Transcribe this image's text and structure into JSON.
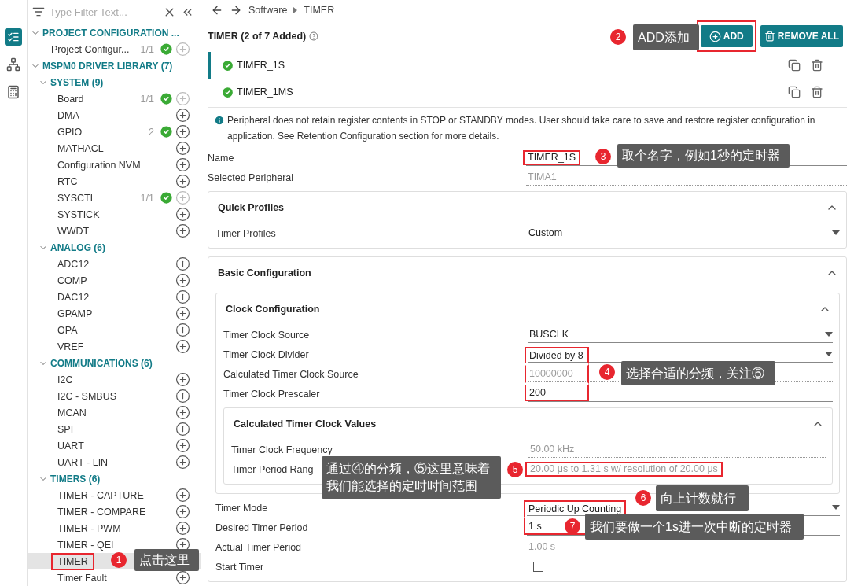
{
  "activity_bar": [
    {
      "kind": "list",
      "selected": true
    },
    {
      "kind": "tree",
      "selected": false
    },
    {
      "kind": "calculator",
      "selected": false
    }
  ],
  "sidebar": {
    "filter": {
      "placeholder": "Type Filter Text..."
    },
    "tree": [
      {
        "label": "PROJECT CONFIGURATION ...",
        "expanded": true,
        "children": [
          {
            "label": "Project Configur...",
            "count": "1/1",
            "added": true,
            "can_add": false,
            "selected": false,
            "highlighted": false
          }
        ]
      },
      {
        "label": "MSPM0 DRIVER LIBRARY (7)",
        "expanded": true,
        "children": [
          {
            "label": "SYSTEM (9)",
            "expanded": true,
            "children": [
              {
                "label": "Board",
                "count": "1/1",
                "added": true,
                "can_add": false,
                "selected": false,
                "highlighted": false
              },
              {
                "label": "DMA",
                "added": false,
                "can_add": true,
                "selected": false,
                "highlighted": false
              },
              {
                "label": "GPIO",
                "count": "2",
                "added": true,
                "can_add": true,
                "selected": false,
                "highlighted": false
              },
              {
                "label": "MATHACL",
                "added": false,
                "can_add": true,
                "selected": false,
                "highlighted": false
              },
              {
                "label": "Configuration NVM",
                "added": false,
                "can_add": true,
                "selected": false,
                "highlighted": false
              },
              {
                "label": "RTC",
                "added": false,
                "can_add": true,
                "selected": false,
                "highlighted": false
              },
              {
                "label": "SYSCTL",
                "count": "1/1",
                "added": true,
                "can_add": false,
                "selected": false,
                "highlighted": false
              },
              {
                "label": "SYSTICK",
                "added": false,
                "can_add": true,
                "selected": false,
                "highlighted": false
              },
              {
                "label": "WWDT",
                "added": false,
                "can_add": true,
                "selected": false,
                "highlighted": false
              }
            ]
          },
          {
            "label": "ANALOG (6)",
            "expanded": true,
            "children": [
              {
                "label": "ADC12",
                "added": false,
                "can_add": true,
                "selected": false,
                "highlighted": false
              },
              {
                "label": "COMP",
                "added": false,
                "can_add": true,
                "selected": false,
                "highlighted": false
              },
              {
                "label": "DAC12",
                "added": false,
                "can_add": true,
                "selected": false,
                "highlighted": false
              },
              {
                "label": "GPAMP",
                "added": false,
                "can_add": true,
                "selected": false,
                "highlighted": false
              },
              {
                "label": "OPA",
                "added": false,
                "can_add": true,
                "selected": false,
                "highlighted": false
              },
              {
                "label": "VREF",
                "added": false,
                "can_add": true,
                "selected": false,
                "highlighted": false
              }
            ]
          },
          {
            "label": "COMMUNICATIONS (6)",
            "expanded": true,
            "children": [
              {
                "label": "I2C",
                "added": false,
                "can_add": true,
                "selected": false,
                "highlighted": false
              },
              {
                "label": "I2C - SMBUS",
                "added": false,
                "can_add": true,
                "selected": false,
                "highlighted": false
              },
              {
                "label": "MCAN",
                "added": false,
                "can_add": true,
                "selected": false,
                "highlighted": false
              },
              {
                "label": "SPI",
                "added": false,
                "can_add": true,
                "selected": false,
                "highlighted": false
              },
              {
                "label": "UART",
                "added": false,
                "can_add": true,
                "selected": false,
                "highlighted": false
              },
              {
                "label": "UART - LIN",
                "added": false,
                "can_add": true,
                "selected": false,
                "highlighted": false
              }
            ]
          },
          {
            "label": "TIMERS (6)",
            "expanded": true,
            "children": [
              {
                "label": "TIMER - CAPTURE",
                "added": false,
                "can_add": true,
                "selected": false,
                "highlighted": false
              },
              {
                "label": "TIMER - COMPARE",
                "added": false,
                "can_add": true,
                "selected": false,
                "highlighted": false
              },
              {
                "label": "TIMER - PWM",
                "added": false,
                "can_add": true,
                "selected": false,
                "highlighted": false
              },
              {
                "label": "TIMER - QEI",
                "added": false,
                "can_add": true,
                "selected": false,
                "highlighted": false
              },
              {
                "label": "TIMER",
                "added": false,
                "selected": true,
                "highlighted": true
              },
              {
                "label": "Timer Fault",
                "added": false,
                "can_add": true,
                "selected": false,
                "highlighted": false
              }
            ]
          }
        ]
      }
    ]
  },
  "breadcrumb": [
    "Software",
    "TIMER"
  ],
  "title": "TIMER (2 of 7 Added)",
  "buttons": [
    {
      "kind": "add",
      "label": "ADD",
      "highlighted": true
    },
    {
      "kind": "remove",
      "label": "REMOVE ALL",
      "highlighted": false
    }
  ],
  "instances": [
    {
      "name": "TIMER_1S",
      "selected": true,
      "valid": true
    },
    {
      "name": "TIMER_1MS",
      "selected": false,
      "valid": true
    }
  ],
  "info": "Peripheral does not retain register contents in STOP or STANDBY modes. User should take care to save and restore register configuration in application. See Retention Configuration section for more details.",
  "form": [
    {
      "kind": "text",
      "label": "Name",
      "value": "TIMER_1S",
      "highlighted": true
    },
    {
      "kind": "readonly",
      "label": "Selected Peripheral",
      "value": "TIMA1",
      "highlighted": false
    },
    {
      "kind": "card",
      "title": "Quick Profiles",
      "expanded": true,
      "children": [
        {
          "kind": "select",
          "label": "Timer Profiles",
          "value": "Custom",
          "highlighted": false
        }
      ]
    },
    {
      "kind": "card",
      "title": "Basic Configuration",
      "expanded": true,
      "children": [
        {
          "kind": "card",
          "title": "Clock Configuration",
          "expanded": true,
          "children": [
            {
              "kind": "select",
              "label": "Timer Clock Source",
              "value": "BUSCLK",
              "highlighted": false
            },
            {
              "kind": "select",
              "label": "Timer Clock Divider",
              "value": "Divided by 8",
              "highlighted": true
            },
            {
              "kind": "readonly",
              "label": "Calculated Timer Clock Source",
              "value": "10000000",
              "highlighted": true
            },
            {
              "kind": "text",
              "label": "Timer Clock Prescaler",
              "value": "200",
              "highlighted": true
            },
            {
              "kind": "card",
              "title": "Calculated Timer Clock Values",
              "expanded": true,
              "children": [
                {
                  "kind": "readonly",
                  "label": "Timer Clock Frequency",
                  "value": "50.00 kHz",
                  "highlighted": false
                },
                {
                  "kind": "readonly",
                  "label": "Timer Period Rang",
                  "value": "20.00 μs to 1.31 s w/ resolution of 20.00 μs",
                  "highlighted": true
                }
              ]
            }
          ]
        },
        {
          "kind": "select",
          "label": "Timer Mode",
          "value": "Periodic Up Counting",
          "highlighted": true
        },
        {
          "kind": "text",
          "label": "Desired Timer Period",
          "value": "1 s",
          "highlighted": true
        },
        {
          "kind": "readonly",
          "label": "Actual Timer Period",
          "value": "1.00 s",
          "highlighted": false
        },
        {
          "kind": "checkbox",
          "label": "Start Timer",
          "checked": false
        }
      ]
    }
  ],
  "annotations": [
    {
      "number": "1",
      "text": "点击这里"
    },
    {
      "number": "2",
      "text": "ADD添加"
    },
    {
      "number": "3",
      "text": "取个名字，例如1秒的定时器"
    },
    {
      "number": "4",
      "text": "选择合适的分频，关注⑤"
    },
    {
      "number": "5",
      "text": "通过④的分频，⑤这里意味着我们能选择的定时时间范围"
    },
    {
      "number": "6",
      "text": "向上计数就行"
    },
    {
      "number": "7",
      "text": "我们要做一个1s进一次中断的定时器"
    }
  ]
}
